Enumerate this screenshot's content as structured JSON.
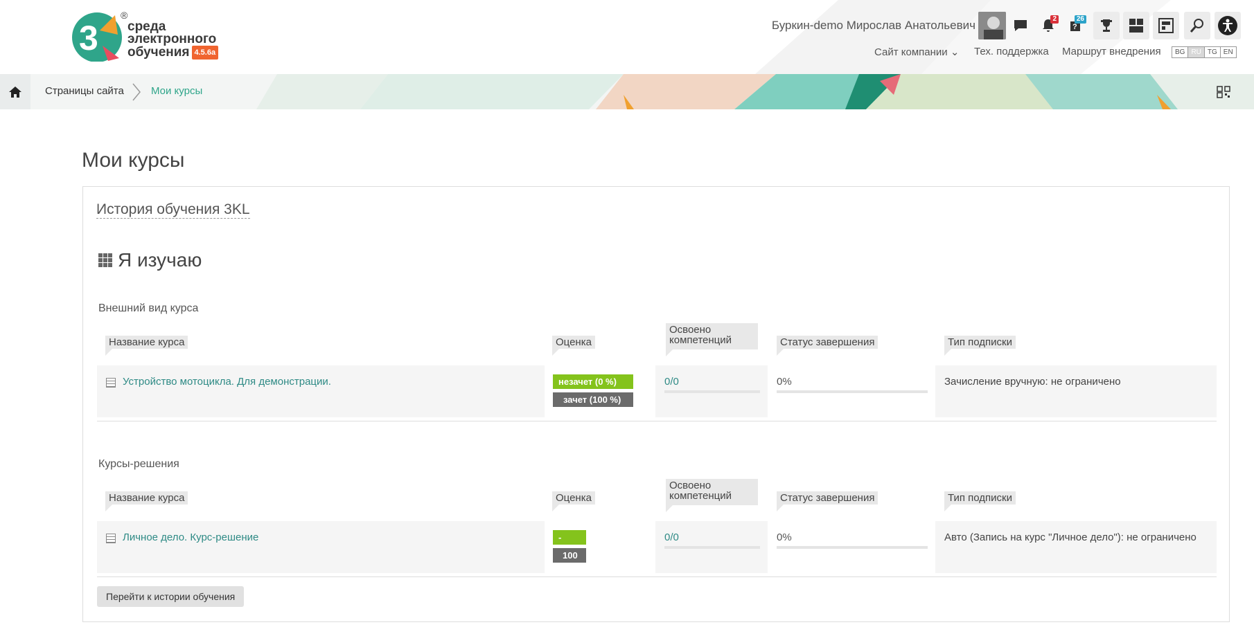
{
  "header": {
    "logo_text": [
      "среда",
      "электронного",
      "обучения"
    ],
    "logo_version": "4.5.6a",
    "logo_reg": "®",
    "user_name": "Буркин-demo Мирослав Анатольевич",
    "notifications_count": "2",
    "questions_count": "26",
    "nav": [
      "Сайт компании",
      "Тех. поддержка",
      "Маршрут внедрения"
    ],
    "languages": [
      "BG",
      "RU",
      "TG",
      "EN"
    ],
    "active_language": "RU"
  },
  "breadcrumb": [
    "Страницы сайта",
    "Мои курсы"
  ],
  "main": {
    "page_title": "Мои курсы",
    "block_title": "История обучения 3KL",
    "section_title": "Я изучаю",
    "columns": [
      "Название курса",
      "Оценка",
      "Освоено компетенций",
      "Статус завершения",
      "Тип подписки"
    ],
    "groups": [
      {
        "title": "Внешний вид курса",
        "course": "Устройство мотоцикла. Для демонстрации.",
        "grade_current": "незачет (0 %)",
        "grade_pass": "зачет (100 %)",
        "competencies": "0/0",
        "completion": "0%",
        "subscription": "Зачисление вручную: не ограничено"
      },
      {
        "title": "Курсы-решения",
        "course": "Личное дело. Курс-решение",
        "grade_current": "-",
        "grade_pass": "100",
        "competencies": "0/0",
        "completion": "0%",
        "subscription": "Авто (Запись на курс \"Личное дело\"): не ограничено"
      }
    ],
    "history_button": "Перейти к истории обучения"
  }
}
